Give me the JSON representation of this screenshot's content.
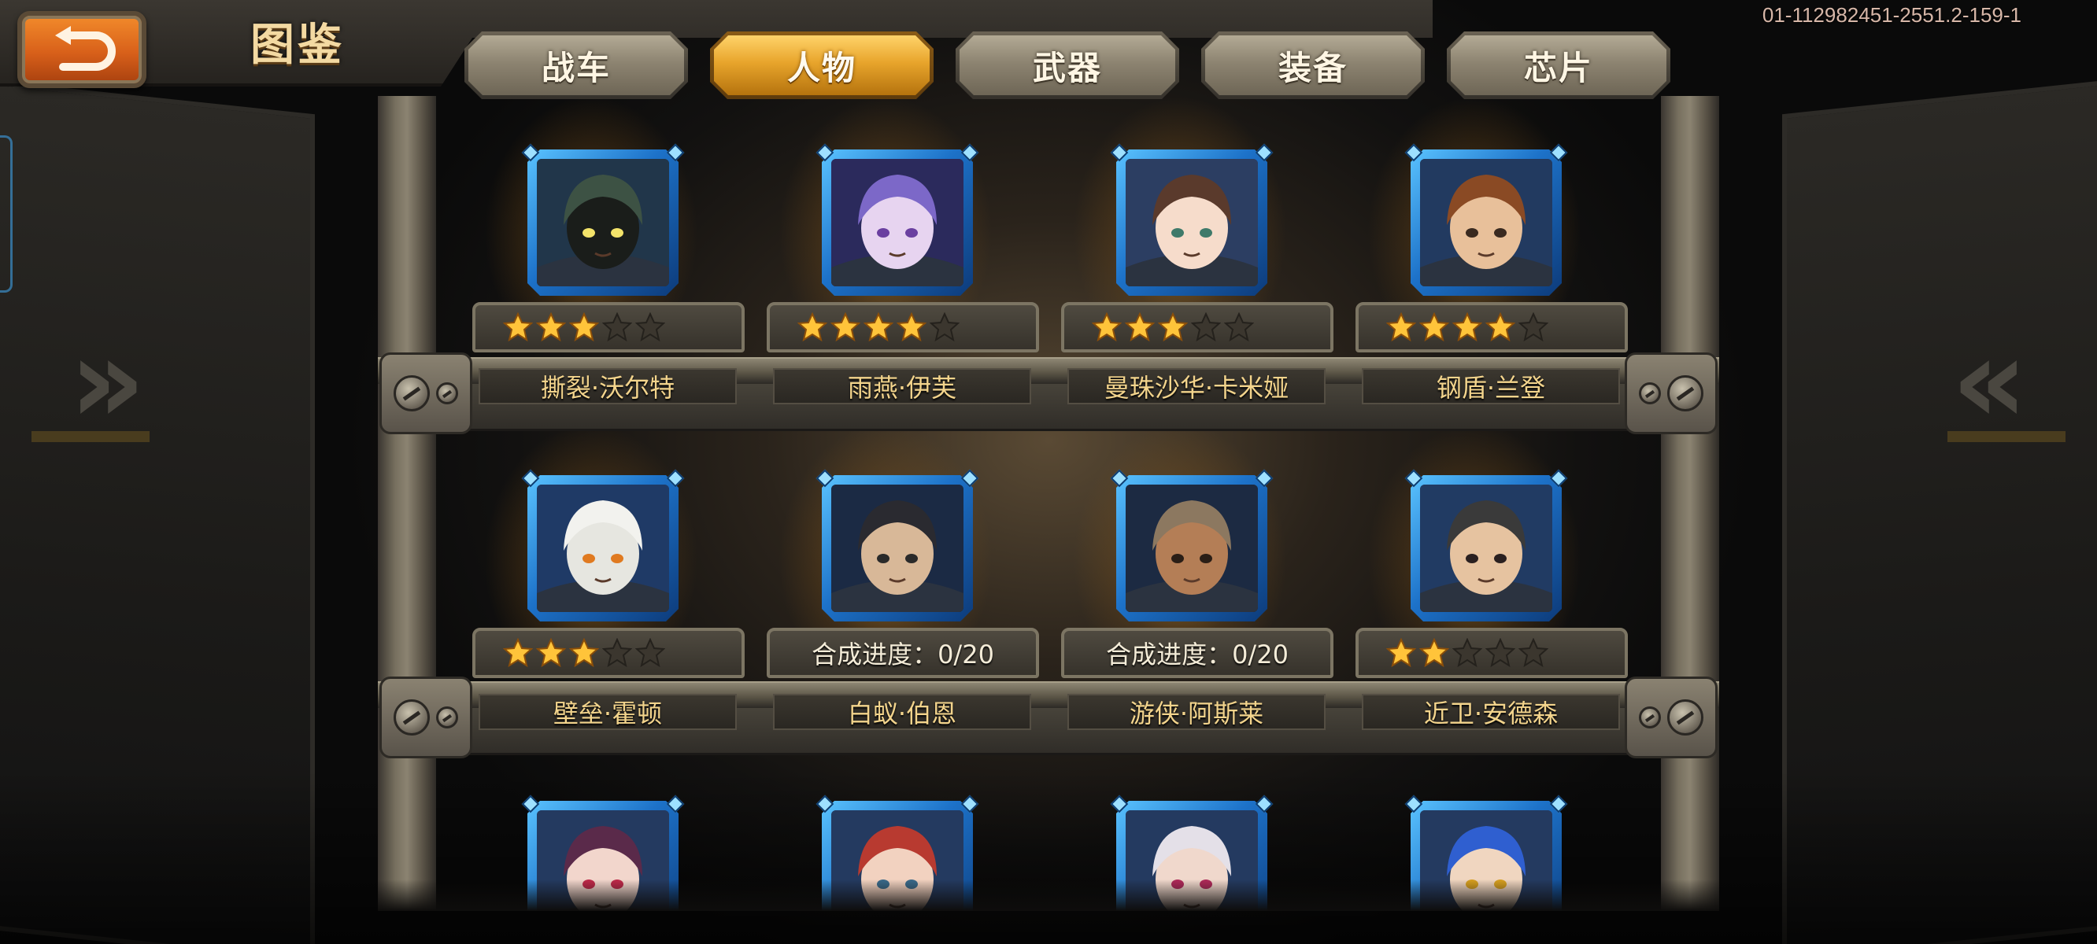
{
  "header": {
    "title": "图鉴",
    "version": "01-112982451-2551.2-159-1",
    "back_icon": "return-arrow-icon"
  },
  "tabs": [
    {
      "label": "战车",
      "active": false
    },
    {
      "label": "人物",
      "active": true
    },
    {
      "label": "武器",
      "active": false
    },
    {
      "label": "装备",
      "active": false
    },
    {
      "label": "芯片",
      "active": false
    }
  ],
  "colors": {
    "accent_gold": "#e8a52c",
    "back_orange": "#d8601a",
    "portrait_blue": "#1d72c9",
    "name_gold": "#f3d48c"
  },
  "characters": [
    {
      "name": "撕裂·沃尔特",
      "stars": 3,
      "max_stars": 5,
      "progress": "",
      "portrait": "hooded-assassin-portrait"
    },
    {
      "name": "雨燕·伊芙",
      "stars": 4,
      "max_stars": 5,
      "progress": "",
      "portrait": "purple-haired-girl-portrait"
    },
    {
      "name": "曼珠沙华·卡米娅",
      "stars": 3,
      "max_stars": 5,
      "progress": "",
      "portrait": "brown-haired-girl-portrait"
    },
    {
      "name": "钢盾·兰登",
      "stars": 4,
      "max_stars": 5,
      "progress": "",
      "portrait": "armored-soldier-portrait"
    },
    {
      "name": "壁垒·霍顿",
      "stars": 3,
      "max_stars": 5,
      "progress": "",
      "portrait": "white-mech-portrait"
    },
    {
      "name": "白蚁·伯恩",
      "stars": 0,
      "max_stars": 5,
      "progress": "合成进度：0/20",
      "portrait": "dark-haired-man-portrait"
    },
    {
      "name": "游侠·阿斯莱",
      "stars": 0,
      "max_stars": 5,
      "progress": "合成进度：0/20",
      "portrait": "cowboy-portrait"
    },
    {
      "name": "近卫·安德森",
      "stars": 2,
      "max_stars": 5,
      "progress": "",
      "portrait": "goggles-commander-portrait"
    },
    {
      "name": "",
      "stars": 0,
      "max_stars": 5,
      "progress": "",
      "portrait": "eyepatch-girl-portrait"
    },
    {
      "name": "",
      "stars": 0,
      "max_stars": 5,
      "progress": "",
      "portrait": "red-haired-girl-portrait"
    },
    {
      "name": "",
      "stars": 0,
      "max_stars": 5,
      "progress": "",
      "portrait": "white-haired-boy-portrait"
    },
    {
      "name": "",
      "stars": 0,
      "max_stars": 5,
      "progress": "",
      "portrait": "blue-haired-boy-portrait"
    }
  ]
}
